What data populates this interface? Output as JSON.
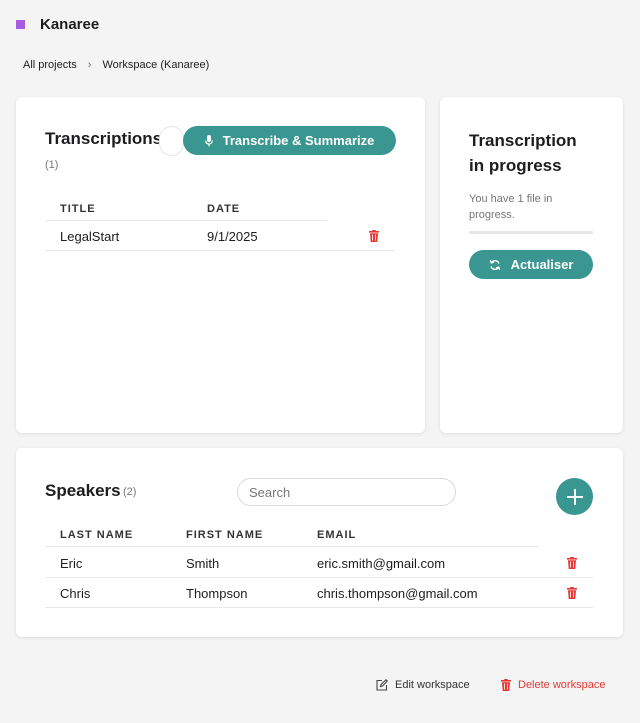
{
  "app": {
    "title": "Kanaree",
    "brand_color": "#a65be0",
    "accent_color": "#3a9690",
    "danger_color": "#e53935"
  },
  "breadcrumb": {
    "items": [
      "All projects",
      "Workspace (Kanaree)"
    ],
    "separator": "›"
  },
  "transcriptions": {
    "title": "Transcriptions",
    "count": "(1)",
    "action_label": "Transcribe & Summarize",
    "action_icon": "microphone-icon",
    "columns": [
      "TITLE",
      "DATE"
    ],
    "rows": [
      {
        "title": "LegalStart",
        "date": "9/1/2025",
        "delete_icon": "trash-icon"
      }
    ]
  },
  "progress": {
    "title_line1": "Transcription",
    "title_line2": "in progress",
    "message_line1": "You have 1 file in",
    "message_line2": "progress.",
    "progress_fraction": 0,
    "refresh_label": "Actualiser",
    "refresh_icon": "refresh-icon"
  },
  "speakers": {
    "title": "Speakers",
    "count": "(2)",
    "search_placeholder": "Search",
    "add_icon": "plus-icon",
    "columns": [
      "LAST NAME",
      "FIRST NAME",
      "EMAIL"
    ],
    "rows": [
      {
        "last_name": "Eric",
        "first_name": "Smith",
        "email": "eric.smith@gmail.com"
      },
      {
        "last_name": "Chris",
        "first_name": "Thompson",
        "email": "chris.thompson@gmail.com"
      }
    ]
  },
  "footer": {
    "edit_label": "Edit workspace",
    "edit_icon": "edit-icon",
    "delete_label": "Delete workspace",
    "delete_icon": "trash-icon"
  }
}
